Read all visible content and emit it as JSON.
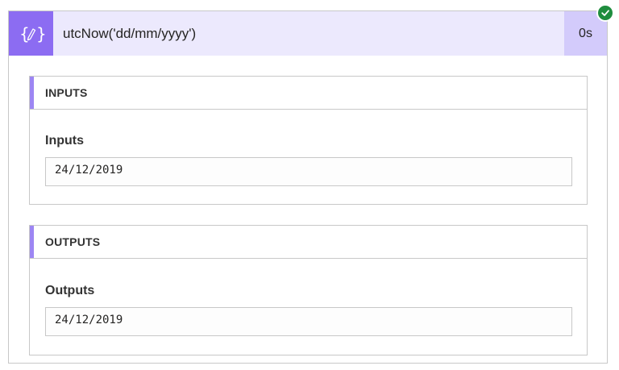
{
  "action": {
    "title": "utcNow('dd/mm/yyyy')",
    "duration": "0s",
    "icon": "curly-braces-pencil-icon",
    "status_icon": "checkmark-icon",
    "colors": {
      "icon_bg": "#8c6cf2",
      "header_bg": "#ece9fd",
      "duration_bg": "#d3cbfb",
      "status_green": "#1f8d3e",
      "section_accent": "#9d86f3"
    }
  },
  "inputs_section": {
    "title": "INPUTS",
    "label": "Inputs",
    "value": "24/12/2019"
  },
  "outputs_section": {
    "title": "OUTPUTS",
    "label": "Outputs",
    "value": "24/12/2019"
  }
}
